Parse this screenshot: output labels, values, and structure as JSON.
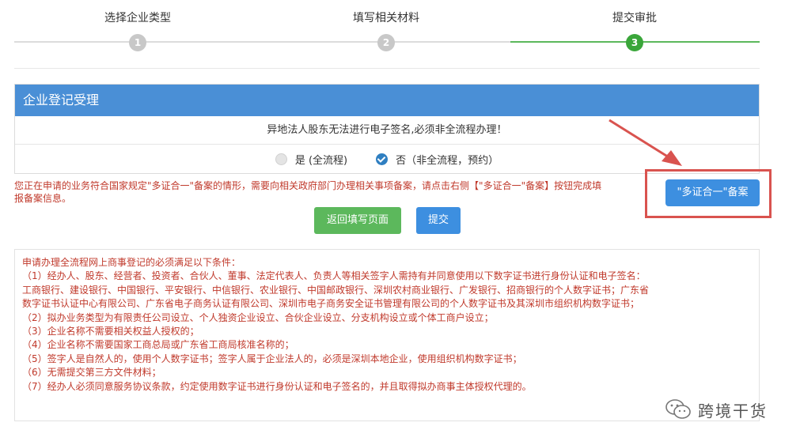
{
  "steps": [
    {
      "label": "选择企业类型",
      "number": "1"
    },
    {
      "label": "填写相关材料",
      "number": "2"
    },
    {
      "label": "提交审批",
      "number": "3"
    }
  ],
  "panel": {
    "title": "企业登记受理",
    "notice": "异地法人股东无法进行电子签名,必须非全流程办理！",
    "option_yes": "是 (全流程)",
    "option_no": "否（非全流程，预约）"
  },
  "red_notice": "您正在申请的业务符合国家规定\"多证合一\"备案的情形，需要向相关政府部门办理相关事项备案，请点击右侧【\"多证合一\"备案】按钮完成填报备案信息。",
  "buttons": {
    "filing": "\"多证合一\"备案",
    "back": "返回填写页面",
    "submit": "提交"
  },
  "conditions": [
    "申请办理全流程网上商事登记的必须满足以下条件：",
    "（1）经办人、股东、经营者、投资者、合伙人、董事、法定代表人、负责人等相关签字人需持有并同意使用以下数字证书进行身份认证和电子签名：",
    "工商银行、建设银行、中国银行、平安银行、中信银行、农业银行、中国邮政银行、深圳农村商业银行、广发银行、招商银行的个人数字证书；广东省",
    "数字证书认证中心有限公司、广东省电子商务认证有限公司、深圳市电子商务安全证书管理有限公司的个人数字证书及其深圳市组织机构数字证书；",
    "（2）拟办业务类型为有限责任公司设立、个人独资企业设立、合伙企业设立、分支机构设立或个体工商户设立；",
    "（3）企业名称不需要相关权益人授权的；",
    "（4）企业名称不需要国家工商总局或广东省工商局核准名称的；",
    "（5）签字人是自然人的，使用个人数字证书；签字人属于企业法人的，必须是深圳本地企业，使用组织机构数字证书；",
    "（6）无需提交第三方文件材料；",
    "（7）经办人必须同意服务协议条款，约定使用数字证书进行身份认证和电子签名的，并且取得拟办商事主体授权代理的。"
  ],
  "watermark": "跨境干货",
  "colors": {
    "panel_header": "#4a8fd6",
    "step_active": "#3aa63a",
    "notice_red": "#c0392b",
    "highlight_red": "#d9534f",
    "button_blue": "#3d8fe0",
    "button_green": "#5cb85c"
  }
}
